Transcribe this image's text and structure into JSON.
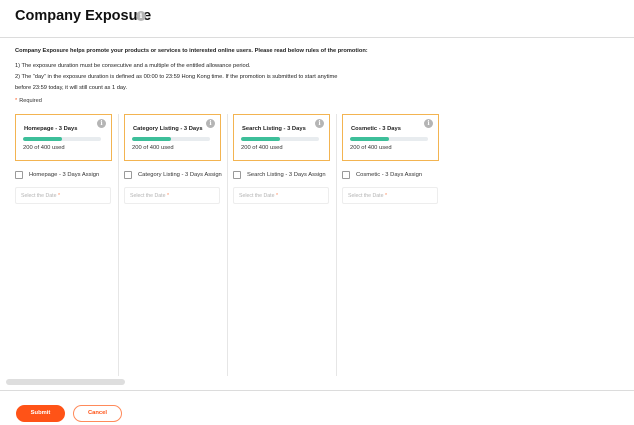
{
  "header": {
    "title": "Company Exposure",
    "info_icon": "info-icon"
  },
  "intro": {
    "lead": "Company Exposure helps promote your products or services to interested online users. Please read below rules of the promotion:",
    "rule_1": "1) The exposure duration must be consecutive and a multiple of the entitled allowance period.",
    "rule_2a": "2) The “day” in the  exposure duration is defined as 00:00 to 23:59 Hong Kong time. If the promotion is submitted to start anytime",
    "rule_2b": "before 23:59 today, it will still count as 1 day."
  },
  "required": {
    "asterisk": "*",
    "label": "Required"
  },
  "options": [
    {
      "title": "Homepage - 3 Days",
      "usage": "200 of 400 used",
      "used_fraction": 0.5,
      "assign_label": "Homepage - 3 Days Assign",
      "date_placeholder": "Select the Date",
      "date_required": "*"
    },
    {
      "title": "Category Listing - 3 Days",
      "usage": "200 of 400 used",
      "used_fraction": 0.5,
      "assign_label": "Category Listing - 3 Days Assign",
      "date_placeholder": "Select the Date",
      "date_required": "*"
    },
    {
      "title": "Search Listing - 3 Days",
      "usage": "200 of 400 used",
      "used_fraction": 0.5,
      "assign_label": "Search Listing - 3 Days Assign",
      "date_placeholder": "Select the Date",
      "date_required": "*"
    },
    {
      "title": "Cosmetic - 3 Days",
      "usage": "200 of 400 used",
      "used_fraction": 0.5,
      "assign_label": "Cosmetic - 3 Days Assign",
      "date_placeholder": "Select the Date",
      "date_required": "*"
    }
  ],
  "footer": {
    "submit_label": "Submit",
    "cancel_label": "Cancel"
  },
  "colors": {
    "accent": "#ff5317",
    "card_border": "#f3b451",
    "progress": "#3dbf9a"
  }
}
